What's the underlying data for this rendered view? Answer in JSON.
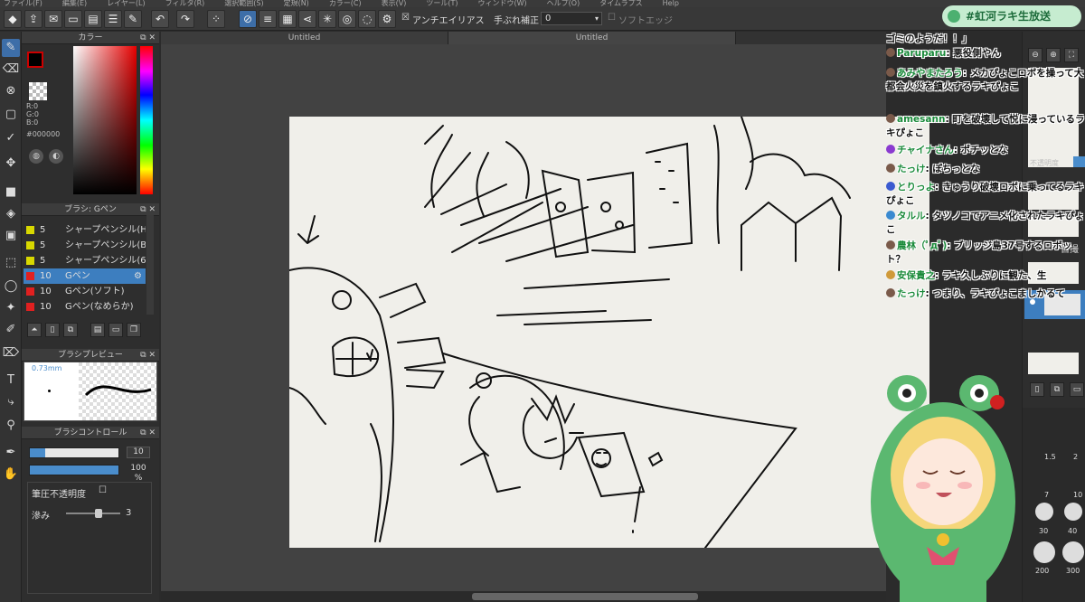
{
  "menubar": [
    "ファイル(F)",
    "編集(E)",
    "レイヤー(L)",
    "フィルタ(R)",
    "選択範囲(S)",
    "定規(N)",
    "カラー(C)",
    "表示(V)",
    "ツール(T)",
    "ウィンドウ(W)",
    "ヘルプ(O)",
    "タイムラプス",
    "Help"
  ],
  "toolbar": {
    "antialias_label": "アンチエイリアス",
    "stabilizer_label": "手ぶれ補正",
    "stabilizer_value": "0",
    "soft_edge_label": "ソフトエッジ"
  },
  "color_panel": {
    "title": "カラー",
    "r": "R:0",
    "g": "G:0",
    "b": "B:0",
    "hex": "#000000"
  },
  "brush_panel": {
    "title": "ブラシ: Gペン",
    "items": [
      {
        "size": "5",
        "name": "シャープペンシル(HB)",
        "color": "#d8d800"
      },
      {
        "size": "5",
        "name": "シャープペンシル(B)",
        "color": "#d8d800"
      },
      {
        "size": "5",
        "name": "シャープペンシル(6B)",
        "color": "#d8d800"
      },
      {
        "size": "10",
        "name": "Gペン",
        "color": "#e02020"
      },
      {
        "size": "10",
        "name": "Gペン(ソフト)",
        "color": "#e02020"
      },
      {
        "size": "10",
        "name": "Gペン(なめらか)",
        "color": "#e02020"
      }
    ]
  },
  "preview_panel": {
    "title": "ブラシプレビュー",
    "size_label": "0.73mm"
  },
  "control_panel": {
    "title": "ブラシコントロール",
    "size_value": "10",
    "size_fraction": 0.17,
    "opacity_value": "100 %",
    "opacity_fraction": 1.0,
    "pressure_label": "筆圧不透明度",
    "blur_label": "滲み",
    "blur_value": "3"
  },
  "tabs": [
    "Untitled",
    "Untitled"
  ],
  "right_panel": {
    "opacity_label": "不透明度",
    "layer_label": "自撮"
  },
  "stream_tag": "#虹河ラキ生放送",
  "chat": [
    {
      "name": "",
      "text": "ゴミのようだ！！」"
    },
    {
      "name": "Paruparu",
      "text": "悪役側やん"
    },
    {
      "name": "あみやまたろう",
      "text": "メカぴょこロボを操って大都会火災を鎮火するラキぴょこ"
    },
    {
      "name": "amesann",
      "text": "町を破壊して悦に浸っているラキぴょこ"
    },
    {
      "name": "チャイナさん",
      "text": "ポチッとな"
    },
    {
      "name": "たっけ",
      "text": "ぽちっとな"
    },
    {
      "name": "とりっよ",
      "text": "きゅうり破壊ロボに乗ってるラキぴょこ"
    },
    {
      "name": "タルル",
      "text": "タツノコでアニメ化されたラキぴょこ"
    },
    {
      "name": "農林（ﾟдﾟ)",
      "text": "ブリッジ島37号するロボット？"
    },
    {
      "name": "安保貴之",
      "text": "ラキ久しぶりに観た、生"
    },
    {
      "name": "たっけ",
      "text": "つまり、ラキぴょこましかるて"
    }
  ],
  "brush_sizes": [
    "1.5",
    "2",
    "7",
    "10",
    "30",
    "40",
    "200",
    "300"
  ]
}
